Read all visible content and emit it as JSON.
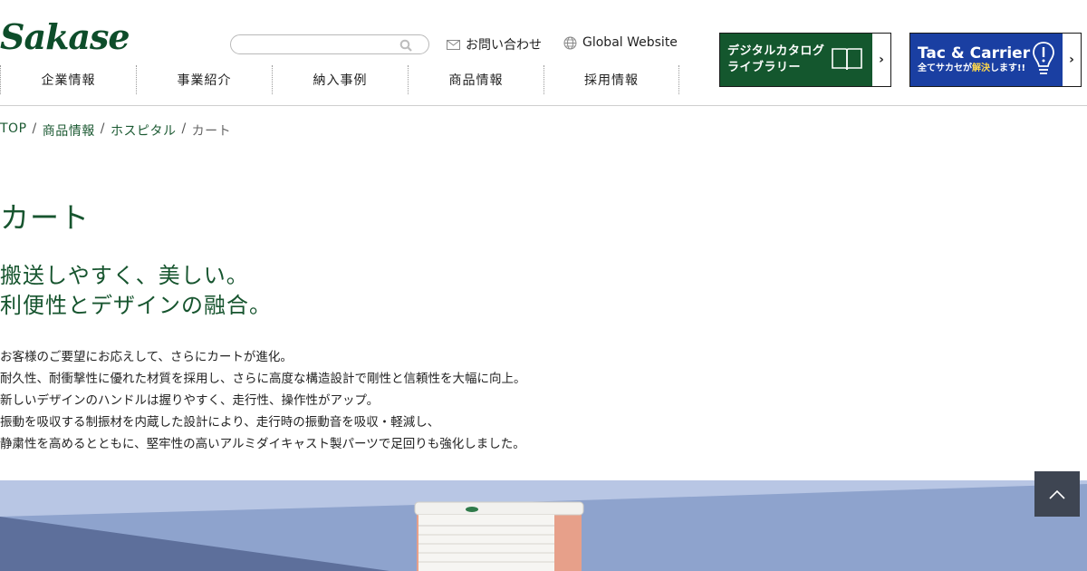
{
  "header": {
    "logo_text": "Sakase",
    "search": {
      "placeholder": "",
      "value": ""
    },
    "contact_label": "お問い合わせ",
    "global_label": "Global Website",
    "nav": [
      "企業情報",
      "事業紹介",
      "納入事例",
      "商品情報",
      "採用情報"
    ],
    "catalog_banner": {
      "line1": "デジタルカタログ",
      "line2": "ライブラリー",
      "arrow": "›"
    },
    "tac_banner": {
      "title": "Tac & Carrier",
      "sub_pre": "全てサカセが",
      "sub_hl": "解決",
      "sub_post": "します!!",
      "arrow": "›"
    }
  },
  "breadcrumb": {
    "items": [
      "TOP",
      "商品情報",
      "ホスピタル"
    ],
    "separator": "/",
    "current": "カート"
  },
  "main": {
    "title": "カート",
    "catch": [
      "搬送しやすく、美しい。",
      "利便性とデザインの融合。"
    ],
    "description": [
      "お客様のご要望にお応えして、さらにカートが進化。",
      "耐久性、耐衝撃性に優れた材質を採用し、さらに高度な構造設計で剛性と信頼性を大幅に向上。",
      "新しいデザインのハンドルは握りやすく、走行性、操作性がアップ。",
      "振動を吸収する制振材を内蔵した設計により、走行時の振動音を吸収・軽減し、",
      "静粛性を高めるとともに、堅牢性の高いアルミダイキャスト製パーツで足回りも強化しました。"
    ]
  },
  "colors": {
    "brand_green": "#14572e",
    "tac_blue": "#1a3fa2",
    "page_top_bg": "#3e4552"
  }
}
